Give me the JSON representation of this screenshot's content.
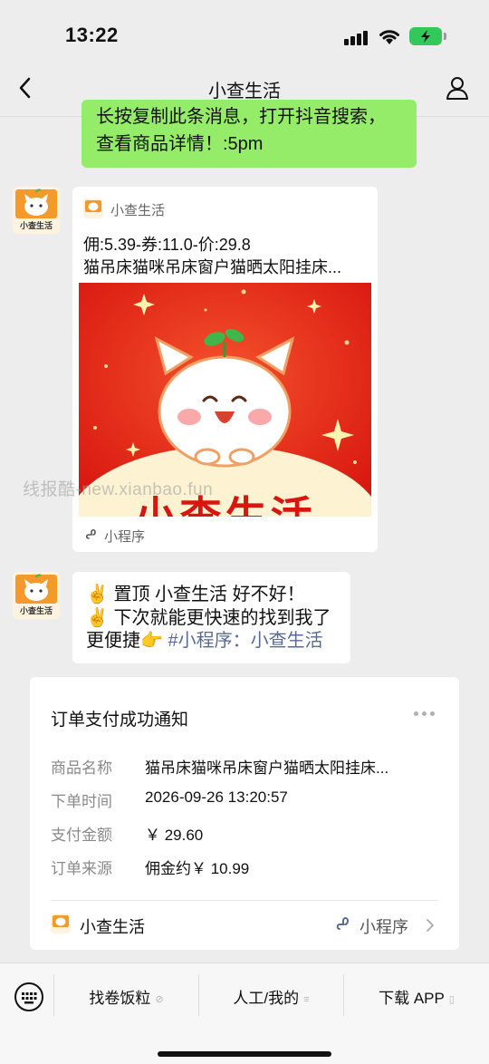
{
  "status_bar": {
    "time": "13:22"
  },
  "nav": {
    "title": "小查生活"
  },
  "green_bubble": {
    "text": "长按复制此条消息，打开抖音搜索，\n查看商品详情！:5pm"
  },
  "mini_program_card": {
    "app_name": "小查生活",
    "line1": "佣:5.39-券:11.0-价:29.8",
    "line2": "猫吊床猫咪吊床窗户猫晒太阳挂床...",
    "image_brand_text": "小查生活",
    "avatar_caption": "小查生活",
    "footer_label": "小程序"
  },
  "watermark": "线报酷-new.xianbao.fun",
  "text_bubble": {
    "line1": "✌️ 置顶 小查生活 好不好！",
    "line2": "✌️ 下次就能更快速的找到我了",
    "line3_prefix": "更便捷👉 ",
    "line3_link": "#小程序：小查生活"
  },
  "order_card": {
    "title": "订单支付成功通知",
    "rows": [
      {
        "label": "商品名称",
        "value": "猫吊床猫咪吊床窗户猫晒太阳挂床..."
      },
      {
        "label": "下单时间",
        "value": "2026-09-26 13:20:57"
      },
      {
        "label": "支付金额",
        "value": "￥ 29.60"
      },
      {
        "label": "订单来源",
        "value": "佣金约￥ 10.99"
      }
    ],
    "brand_name": "小查生活",
    "mini_program_label": "小程序"
  },
  "bottom_menu": {
    "items": [
      {
        "label": "找卷饭粒"
      },
      {
        "label": "人工/我的"
      },
      {
        "label": "下载 APP"
      }
    ]
  },
  "colors": {
    "bubble_green": "#95ec69",
    "link": "#576b95",
    "battery": "#34c759",
    "image_red": "#e8261c"
  },
  "icons": [
    "signal-icon",
    "wifi-icon",
    "battery-icon",
    "back-arrow-icon",
    "profile-icon",
    "mini-program-icon",
    "more-icon",
    "chevron-right-icon",
    "keyboard-icon"
  ]
}
